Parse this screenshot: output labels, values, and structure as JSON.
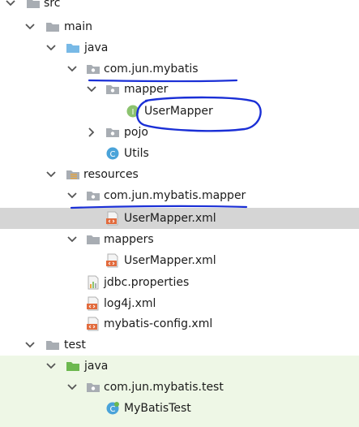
{
  "tree": {
    "src": "src",
    "main": "main",
    "java": "java",
    "pkg_main": "com.jun.mybatis",
    "mapper": "mapper",
    "user_mapper": "UserMapper",
    "pojo": "pojo",
    "utils": "Utils",
    "resources": "resources",
    "pkg_res": "com.jun.mybatis.mapper",
    "user_mapper_xml": "UserMapper.xml",
    "mappers": "mappers",
    "user_mapper_xml2": "UserMapper.xml",
    "jdbc": "jdbc.properties",
    "log4j": "log4j.xml",
    "mybatis_config": "mybatis-config.xml",
    "test": "test",
    "test_java": "java",
    "pkg_test": "com.jun.mybatis.test",
    "mybatis_test": "MyBatisTest"
  },
  "icons": {
    "interface_letter": "I",
    "class_letter": "C"
  },
  "colors": {
    "selection": "#d5d5d5",
    "test_bg": "#eef7e6",
    "annotation": "#1a2fd6"
  }
}
